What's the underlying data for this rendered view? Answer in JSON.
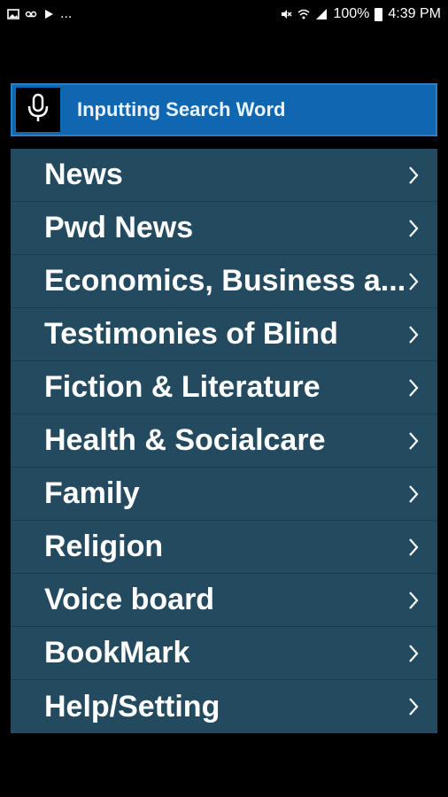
{
  "status_bar": {
    "left_icons": [
      "image-icon",
      "voicemail-icon",
      "media-icon",
      "more-dots"
    ],
    "more_dots": "...",
    "right_icons": [
      "mute-icon",
      "wifi-icon",
      "signal-icon"
    ],
    "battery_percent": "100%",
    "time": "4:39 PM"
  },
  "search": {
    "icon": "mic-icon",
    "label": "Inputting Search Word"
  },
  "menu": {
    "items": [
      {
        "label": "News"
      },
      {
        "label": "Pwd News"
      },
      {
        "label": "Economics, Business a..."
      },
      {
        "label": "Testimonies of Blind"
      },
      {
        "label": "Fiction & Literature"
      },
      {
        "label": "Health & Socialcare"
      },
      {
        "label": "Family"
      },
      {
        "label": "Religion"
      },
      {
        "label": "Voice board"
      },
      {
        "label": "BookMark"
      },
      {
        "label": "Help/Setting"
      }
    ]
  },
  "colors": {
    "background": "#000000",
    "search_bar": "#0f67b1",
    "menu_background": "#234a5f",
    "divider": "#1b3a4b",
    "text": "#ffffff"
  }
}
